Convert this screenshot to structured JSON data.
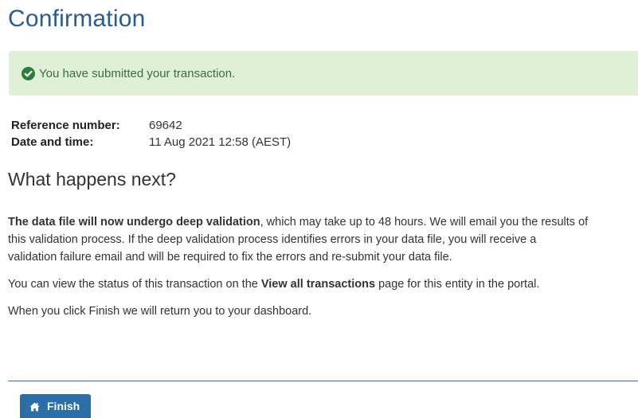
{
  "page": {
    "title": "Confirmation"
  },
  "alert": {
    "message": "You have submitted your transaction.",
    "icon": "check-circle-icon",
    "background": "#dff0d8",
    "icon_color": "#2e7d3a"
  },
  "details": {
    "reference_label": "Reference number:",
    "reference_value": "69642",
    "datetime_label": "Date and time:",
    "datetime_value": "11 Aug 2021 12:58 (AEST)"
  },
  "next": {
    "heading": "What happens next?",
    "para1_bold": "The data file will now undergo deep validation",
    "para1_line1_rest": ", which may take up to 48 hours. We will email you the results of",
    "para1_line2": "this validation process. If the deep validation process identifies errors in your data file, you will receive a",
    "para1_line3": "validation failure email and will be required to fix the errors and re-submit your data file.",
    "para2_before": "You can view the status of this transaction on the ",
    "para2_bold": "View all transactions",
    "para2_after": " page for this entity in the portal.",
    "para3": "When you click Finish we will return you to your dashboard."
  },
  "actions": {
    "finish_label": "Finish",
    "finish_icon": "home-icon",
    "accent": "#2a6fa8"
  }
}
